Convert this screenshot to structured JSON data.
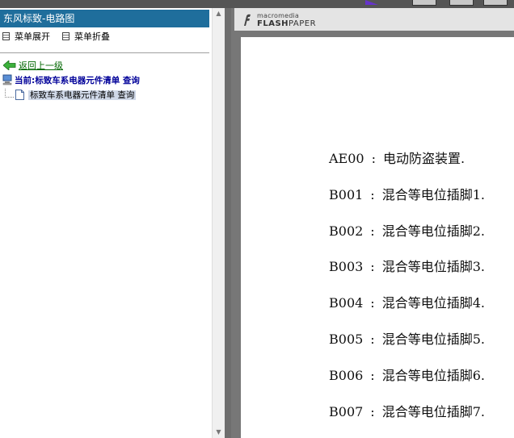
{
  "left_panel": {
    "title": "东风标致-电路图",
    "menu_expand": "菜单展开",
    "menu_collapse": "菜单折叠",
    "back_link": "返回上一级",
    "current_label": "当前:标致车系电器元件清单 查询",
    "tree_item": "标致车系电器元件清单 查询"
  },
  "viewer": {
    "logo_small": "macromedia",
    "logo_flash": "FLASH",
    "logo_paper": "PAPER",
    "lines": [
      {
        "code": "AE00",
        "text": "电动防盗装置."
      },
      {
        "code": "B001",
        "text": "混合等电位插脚1."
      },
      {
        "code": "B002",
        "text": "混合等电位插脚2."
      },
      {
        "code": "B003",
        "text": "混合等电位插脚3."
      },
      {
        "code": "B004",
        "text": "混合等电位插脚4."
      },
      {
        "code": "B005",
        "text": "混合等电位插脚5."
      },
      {
        "code": "B006",
        "text": "混合等电位插脚6."
      },
      {
        "code": "B007",
        "text": "混合等电位插脚7."
      }
    ]
  },
  "colors": {
    "title_bar": "#1f6e9c",
    "link_green": "#006600",
    "current_blue": "#000099",
    "viewer_bg": "#777777"
  }
}
